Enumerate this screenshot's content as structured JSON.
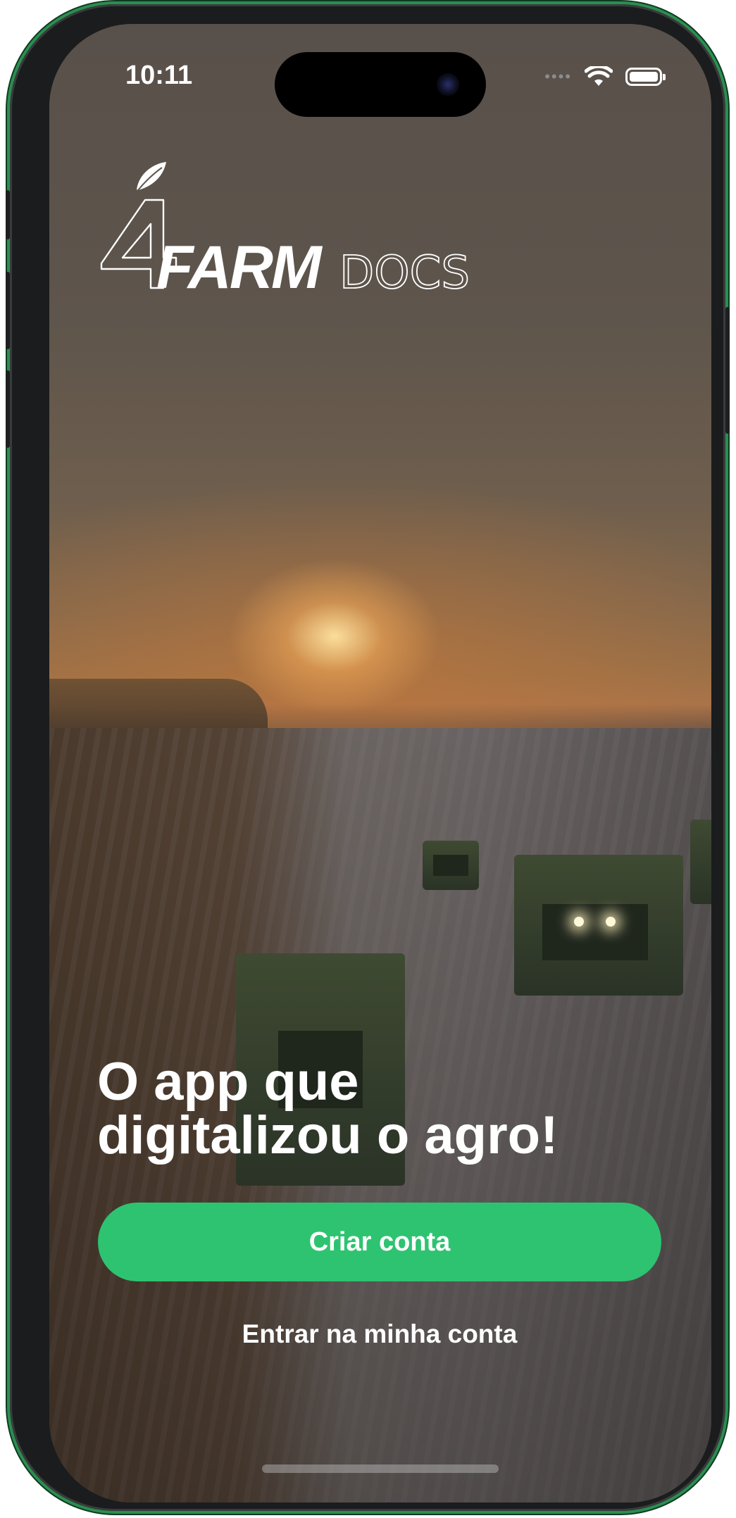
{
  "status_bar": {
    "time": "10:11",
    "signal_icon": "signal-dots-icon",
    "wifi_icon": "wifi-icon",
    "battery_icon": "battery-icon"
  },
  "logo": {
    "brand": "4FARMDOCS",
    "icon": "leaf-icon"
  },
  "hero": {
    "headline_line1": "O app que",
    "headline_line2": "digitalizou o agro!"
  },
  "actions": {
    "create_account_label": "Criar conta",
    "login_label": "Entrar na minha conta"
  },
  "colors": {
    "accent": "#2ec370",
    "text": "#ffffff",
    "device_frame": "#1b1c1d"
  }
}
